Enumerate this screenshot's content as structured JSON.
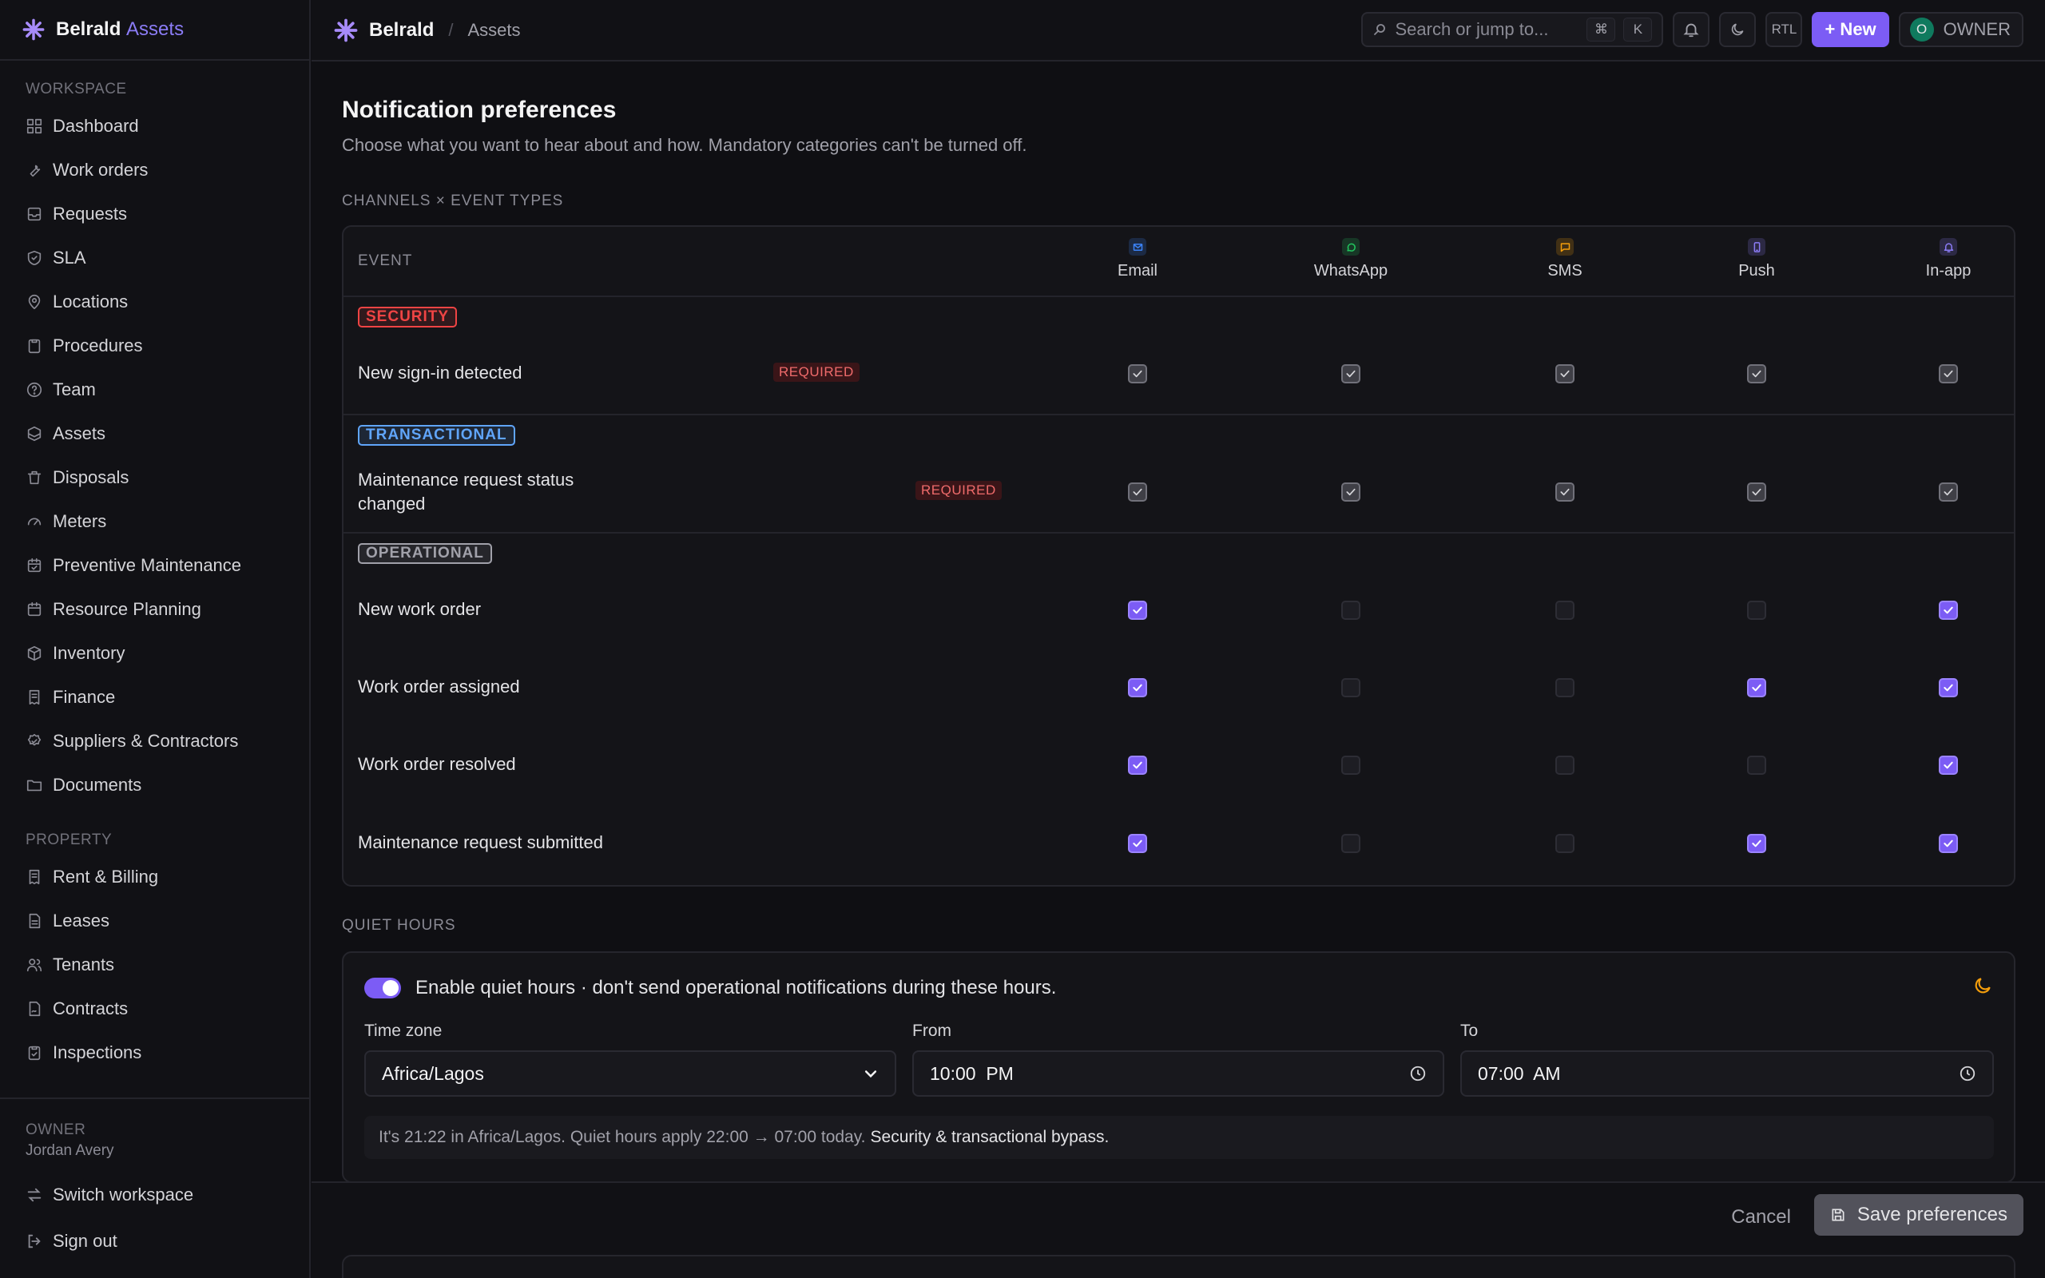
{
  "brand": {
    "name": "Belrald",
    "accent": "Assets"
  },
  "sidebar": {
    "workspace_title": "WORKSPACE",
    "workspace_items": [
      {
        "label": "Dashboard",
        "icon": "dashboard-icon"
      },
      {
        "label": "Work orders",
        "icon": "wrench-icon"
      },
      {
        "label": "Requests",
        "icon": "inbox-icon"
      },
      {
        "label": "SLA",
        "icon": "shield-check-icon"
      },
      {
        "label": "Locations",
        "icon": "map-pin-icon"
      },
      {
        "label": "Procedures",
        "icon": "clipboard-icon"
      },
      {
        "label": "Team",
        "icon": "help-circle-icon"
      },
      {
        "label": "Assets",
        "icon": "boxes-icon"
      },
      {
        "label": "Disposals",
        "icon": "trash-icon"
      },
      {
        "label": "Meters",
        "icon": "gauge-icon"
      },
      {
        "label": "Preventive Maintenance",
        "icon": "calendar-check-icon"
      },
      {
        "label": "Resource Planning",
        "icon": "calendar-icon"
      },
      {
        "label": "Inventory",
        "icon": "package-icon"
      },
      {
        "label": "Finance",
        "icon": "receipt-icon"
      },
      {
        "label": "Suppliers & Contractors",
        "icon": "badge-check-icon"
      },
      {
        "label": "Documents",
        "icon": "folder-icon"
      }
    ],
    "property_title": "PROPERTY",
    "property_items": [
      {
        "label": "Rent & Billing",
        "icon": "receipt-icon"
      },
      {
        "label": "Leases",
        "icon": "file-text-icon"
      },
      {
        "label": "Tenants",
        "icon": "users-icon"
      },
      {
        "label": "Contracts",
        "icon": "file-signature-icon"
      },
      {
        "label": "Inspections",
        "icon": "clipboard-check-icon"
      }
    ],
    "user": {
      "role": "OWNER",
      "name": "Jordan Avery"
    },
    "switch_workspace": "Switch workspace",
    "sign_out": "Sign out"
  },
  "topbar": {
    "crumb_main": "Belrald",
    "crumb_sep": "/",
    "crumb_sub": "Assets",
    "search_placeholder": "Search or jump to...",
    "kbd_cmd": "⌘",
    "kbd_k": "K",
    "rtl": "RTL",
    "new_label": "+ New",
    "avatar_initial": "O",
    "owner_label": "OWNER"
  },
  "page": {
    "title": "Notification preferences",
    "subtitle": "Choose what you want to hear about and how. Mandatory categories can't be turned off.",
    "matrix_label": "CHANNELS × EVENT TYPES",
    "event_col": "EVENT",
    "required_label": "REQUIRED"
  },
  "channels": [
    {
      "label": "Email",
      "icon": "mail-icon",
      "color": "#3b82f6"
    },
    {
      "label": "WhatsApp",
      "icon": "whatsapp-icon",
      "color": "#22c55e"
    },
    {
      "label": "SMS",
      "icon": "message-icon",
      "color": "#f59e0b"
    },
    {
      "label": "Push",
      "icon": "smartphone-icon",
      "color": "#8b7cf6"
    },
    {
      "label": "In-app",
      "icon": "bell-icon",
      "color": "#8b7cf6"
    }
  ],
  "groups": [
    {
      "name": "SECURITY",
      "color": "#ef4444",
      "events": [
        {
          "label": "New sign-in detected",
          "required": true,
          "values": [
            true,
            true,
            true,
            true,
            true
          ]
        }
      ]
    },
    {
      "name": "TRANSACTIONAL",
      "color": "#60a5fa",
      "events": [
        {
          "label": "Maintenance request status changed",
          "required": true,
          "values": [
            true,
            true,
            true,
            true,
            true
          ]
        }
      ]
    },
    {
      "name": "OPERATIONAL",
      "color": "#a1a1aa",
      "events": [
        {
          "label": "New work order",
          "required": false,
          "values": [
            true,
            false,
            false,
            false,
            true
          ]
        },
        {
          "label": "Work order assigned",
          "required": false,
          "values": [
            true,
            false,
            false,
            true,
            true
          ]
        },
        {
          "label": "Work order resolved",
          "required": false,
          "values": [
            true,
            false,
            false,
            false,
            true
          ]
        },
        {
          "label": "Maintenance request submitted",
          "required": false,
          "values": [
            true,
            false,
            false,
            true,
            true
          ]
        }
      ]
    }
  ],
  "quiet_hours": {
    "section_label": "QUIET HOURS",
    "enabled": true,
    "toggle_text": "Enable quiet hours · don't send operational notifications during these hours.",
    "timezone_label": "Time zone",
    "timezone_value": "Africa/Lagos",
    "from_label": "From",
    "from_value": "10:00  PM",
    "to_label": "To",
    "to_value": "07:00  AM",
    "note": "It's 21:22 in Africa/Lagos. Quiet hours apply 22:00 → 07:00 today.",
    "note_strong": "Security & transactional bypass."
  },
  "footer": {
    "cancel": "Cancel",
    "save": "Save preferences"
  },
  "colors": {
    "accent": "#7c5cf5",
    "background": "#0f0f13",
    "required": "#ef6b6b"
  }
}
